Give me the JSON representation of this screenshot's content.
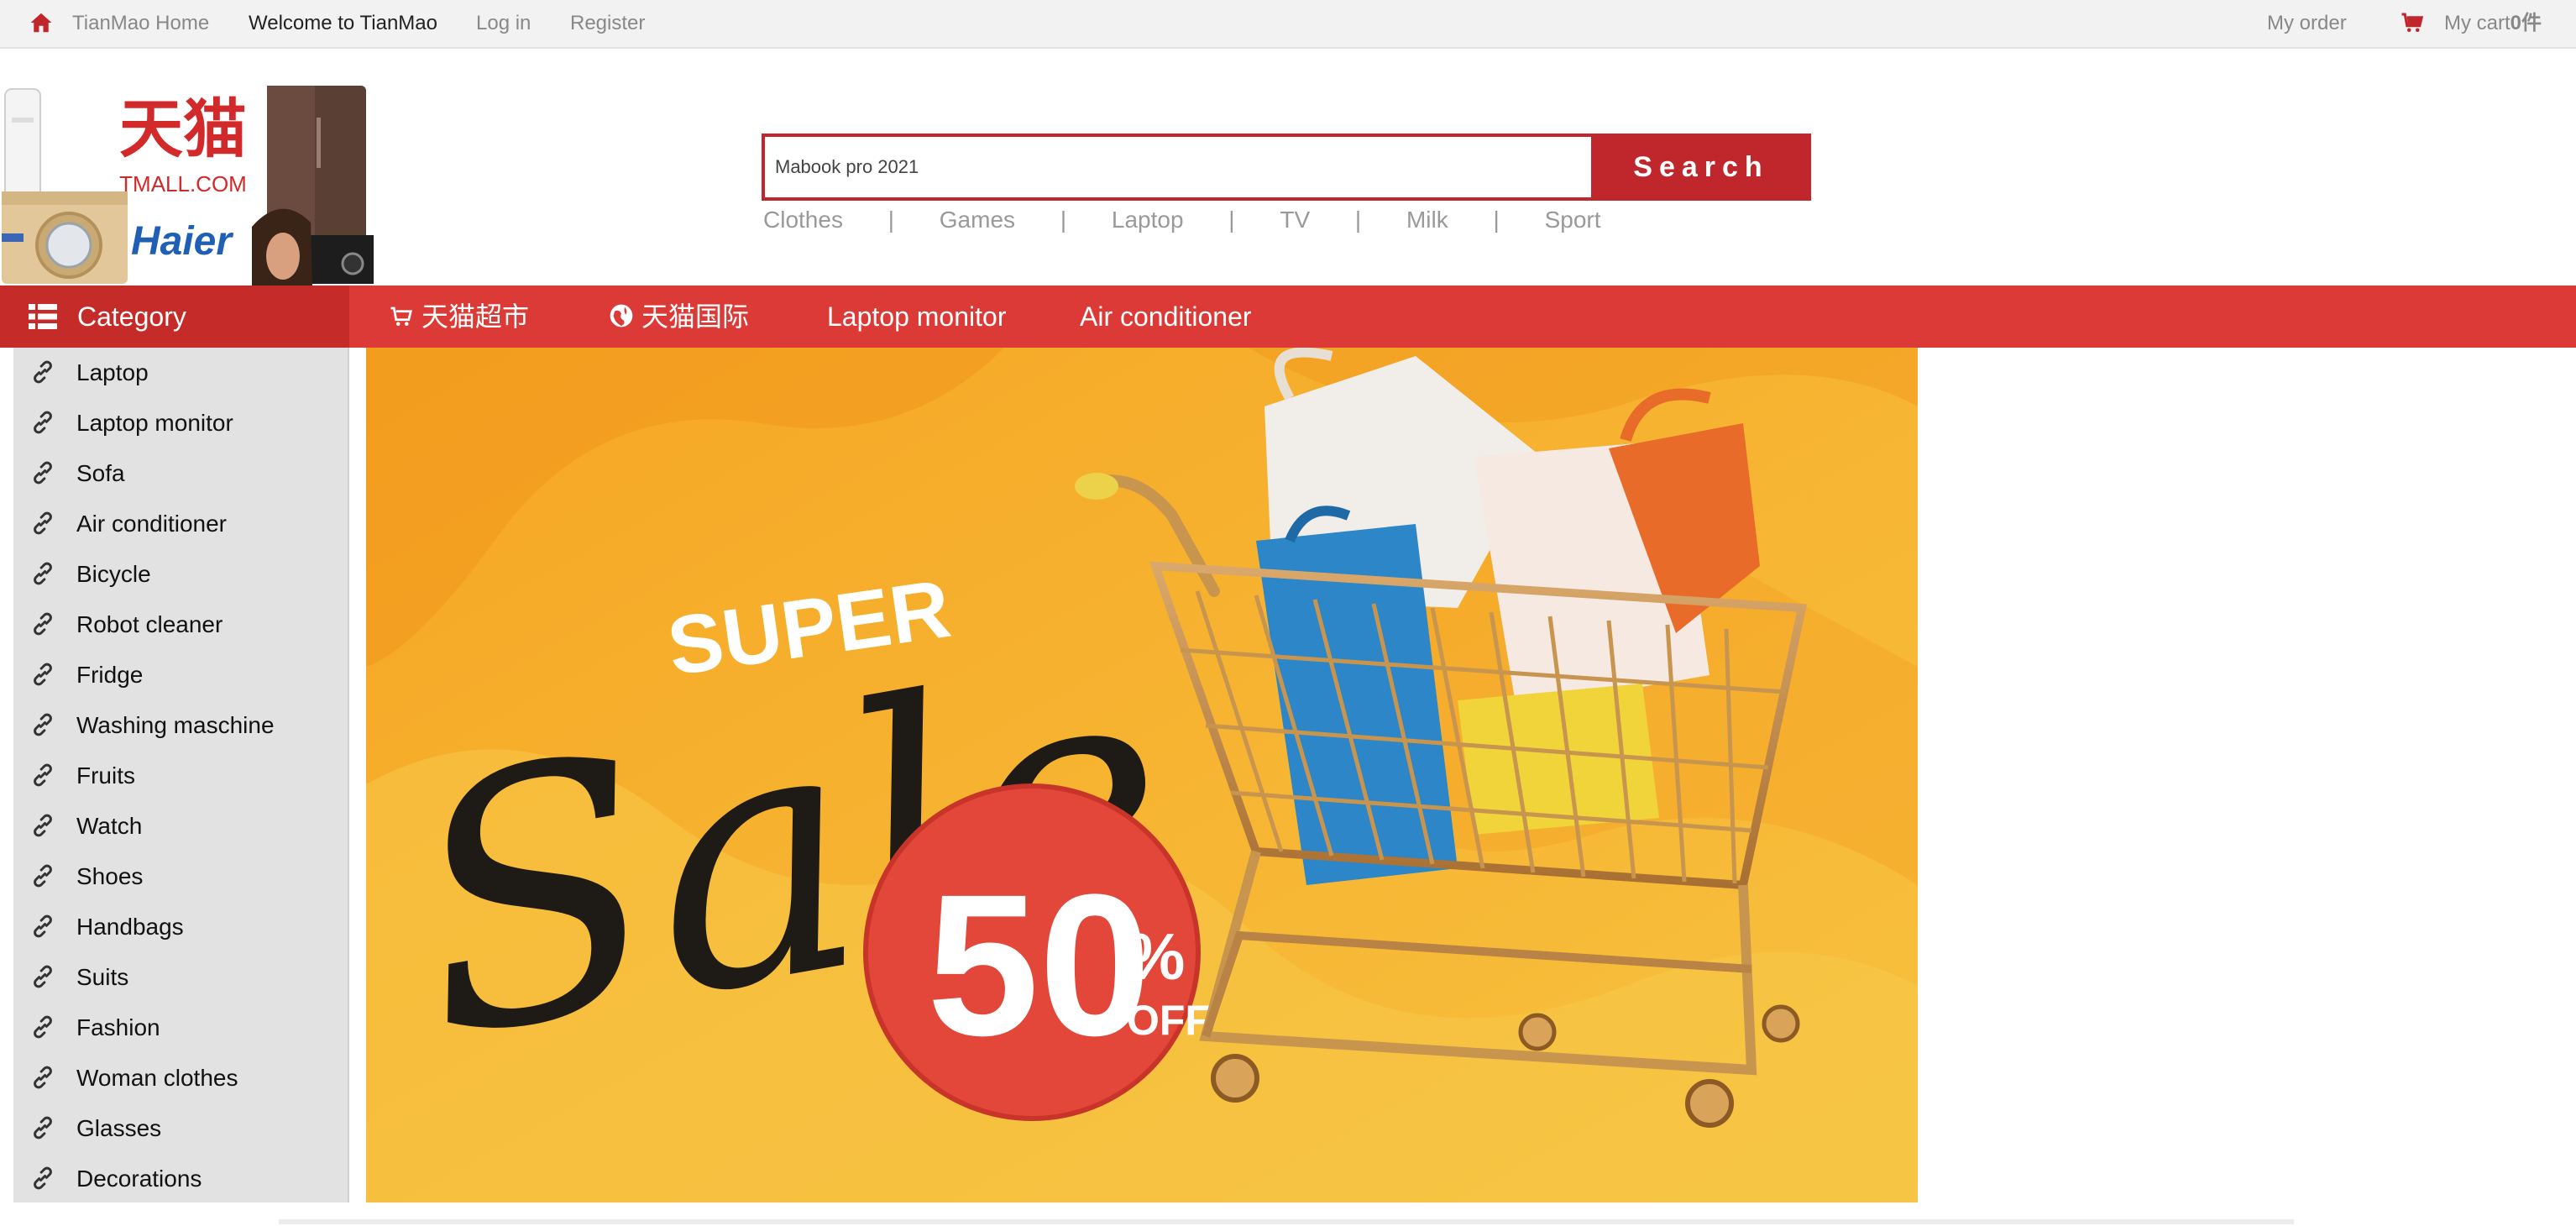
{
  "topbar": {
    "home_label": "TianMao Home",
    "welcome": "Welcome to TianMao",
    "login": "Log in",
    "register": "Register",
    "my_order": "My order",
    "cart_label": "My cart",
    "cart_count": "0件"
  },
  "logo": {
    "brand_cn": "天猫",
    "brand_domain": "TMALL.COM",
    "partner": "Haier"
  },
  "search": {
    "value": "Mabook pro 2021",
    "button": "Search",
    "hot_links": [
      "Clothes",
      "Games",
      "Laptop",
      "TV",
      "Milk",
      "Sport"
    ],
    "separator": "|"
  },
  "nav": {
    "category": "Category",
    "items": [
      "天猫超市",
      "天猫国际",
      "Laptop monitor",
      "Air conditioner"
    ]
  },
  "sidebar": {
    "items": [
      "Laptop",
      "Laptop monitor",
      "Sofa",
      "Air conditioner",
      "Bicycle",
      "Robot cleaner",
      "Fridge",
      "Washing maschine",
      "Fruits",
      "Watch",
      "Shoes",
      "Handbags",
      "Suits",
      "Fashion",
      "Woman clothes",
      "Glasses",
      "Decorations"
    ]
  },
  "banner": {
    "super": "SUPER",
    "sale": "Sale",
    "discount": "50",
    "percent": "%",
    "off": "OFF"
  },
  "colors": {
    "brand_red": "#c0272d",
    "nav_red": "#dc3a36",
    "banner_yellow": "#f3b12a"
  }
}
